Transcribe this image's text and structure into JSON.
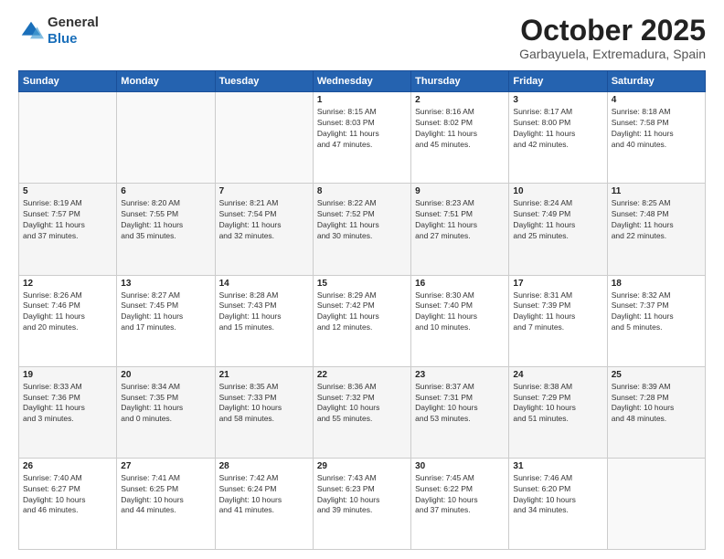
{
  "header": {
    "logo": {
      "general": "General",
      "blue": "Blue"
    },
    "title": "October 2025",
    "location": "Garbayuela, Extremadura, Spain"
  },
  "weekdays": [
    "Sunday",
    "Monday",
    "Tuesday",
    "Wednesday",
    "Thursday",
    "Friday",
    "Saturday"
  ],
  "weeks": [
    {
      "days": [
        {
          "number": "",
          "content": ""
        },
        {
          "number": "",
          "content": ""
        },
        {
          "number": "",
          "content": ""
        },
        {
          "number": "1",
          "content": "Sunrise: 8:15 AM\nSunset: 8:03 PM\nDaylight: 11 hours\nand 47 minutes."
        },
        {
          "number": "2",
          "content": "Sunrise: 8:16 AM\nSunset: 8:02 PM\nDaylight: 11 hours\nand 45 minutes."
        },
        {
          "number": "3",
          "content": "Sunrise: 8:17 AM\nSunset: 8:00 PM\nDaylight: 11 hours\nand 42 minutes."
        },
        {
          "number": "4",
          "content": "Sunrise: 8:18 AM\nSunset: 7:58 PM\nDaylight: 11 hours\nand 40 minutes."
        }
      ]
    },
    {
      "days": [
        {
          "number": "5",
          "content": "Sunrise: 8:19 AM\nSunset: 7:57 PM\nDaylight: 11 hours\nand 37 minutes."
        },
        {
          "number": "6",
          "content": "Sunrise: 8:20 AM\nSunset: 7:55 PM\nDaylight: 11 hours\nand 35 minutes."
        },
        {
          "number": "7",
          "content": "Sunrise: 8:21 AM\nSunset: 7:54 PM\nDaylight: 11 hours\nand 32 minutes."
        },
        {
          "number": "8",
          "content": "Sunrise: 8:22 AM\nSunset: 7:52 PM\nDaylight: 11 hours\nand 30 minutes."
        },
        {
          "number": "9",
          "content": "Sunrise: 8:23 AM\nSunset: 7:51 PM\nDaylight: 11 hours\nand 27 minutes."
        },
        {
          "number": "10",
          "content": "Sunrise: 8:24 AM\nSunset: 7:49 PM\nDaylight: 11 hours\nand 25 minutes."
        },
        {
          "number": "11",
          "content": "Sunrise: 8:25 AM\nSunset: 7:48 PM\nDaylight: 11 hours\nand 22 minutes."
        }
      ]
    },
    {
      "days": [
        {
          "number": "12",
          "content": "Sunrise: 8:26 AM\nSunset: 7:46 PM\nDaylight: 11 hours\nand 20 minutes."
        },
        {
          "number": "13",
          "content": "Sunrise: 8:27 AM\nSunset: 7:45 PM\nDaylight: 11 hours\nand 17 minutes."
        },
        {
          "number": "14",
          "content": "Sunrise: 8:28 AM\nSunset: 7:43 PM\nDaylight: 11 hours\nand 15 minutes."
        },
        {
          "number": "15",
          "content": "Sunrise: 8:29 AM\nSunset: 7:42 PM\nDaylight: 11 hours\nand 12 minutes."
        },
        {
          "number": "16",
          "content": "Sunrise: 8:30 AM\nSunset: 7:40 PM\nDaylight: 11 hours\nand 10 minutes."
        },
        {
          "number": "17",
          "content": "Sunrise: 8:31 AM\nSunset: 7:39 PM\nDaylight: 11 hours\nand 7 minutes."
        },
        {
          "number": "18",
          "content": "Sunrise: 8:32 AM\nSunset: 7:37 PM\nDaylight: 11 hours\nand 5 minutes."
        }
      ]
    },
    {
      "days": [
        {
          "number": "19",
          "content": "Sunrise: 8:33 AM\nSunset: 7:36 PM\nDaylight: 11 hours\nand 3 minutes."
        },
        {
          "number": "20",
          "content": "Sunrise: 8:34 AM\nSunset: 7:35 PM\nDaylight: 11 hours\nand 0 minutes."
        },
        {
          "number": "21",
          "content": "Sunrise: 8:35 AM\nSunset: 7:33 PM\nDaylight: 10 hours\nand 58 minutes."
        },
        {
          "number": "22",
          "content": "Sunrise: 8:36 AM\nSunset: 7:32 PM\nDaylight: 10 hours\nand 55 minutes."
        },
        {
          "number": "23",
          "content": "Sunrise: 8:37 AM\nSunset: 7:31 PM\nDaylight: 10 hours\nand 53 minutes."
        },
        {
          "number": "24",
          "content": "Sunrise: 8:38 AM\nSunset: 7:29 PM\nDaylight: 10 hours\nand 51 minutes."
        },
        {
          "number": "25",
          "content": "Sunrise: 8:39 AM\nSunset: 7:28 PM\nDaylight: 10 hours\nand 48 minutes."
        }
      ]
    },
    {
      "days": [
        {
          "number": "26",
          "content": "Sunrise: 7:40 AM\nSunset: 6:27 PM\nDaylight: 10 hours\nand 46 minutes."
        },
        {
          "number": "27",
          "content": "Sunrise: 7:41 AM\nSunset: 6:25 PM\nDaylight: 10 hours\nand 44 minutes."
        },
        {
          "number": "28",
          "content": "Sunrise: 7:42 AM\nSunset: 6:24 PM\nDaylight: 10 hours\nand 41 minutes."
        },
        {
          "number": "29",
          "content": "Sunrise: 7:43 AM\nSunset: 6:23 PM\nDaylight: 10 hours\nand 39 minutes."
        },
        {
          "number": "30",
          "content": "Sunrise: 7:45 AM\nSunset: 6:22 PM\nDaylight: 10 hours\nand 37 minutes."
        },
        {
          "number": "31",
          "content": "Sunrise: 7:46 AM\nSunset: 6:20 PM\nDaylight: 10 hours\nand 34 minutes."
        },
        {
          "number": "",
          "content": ""
        }
      ]
    }
  ]
}
